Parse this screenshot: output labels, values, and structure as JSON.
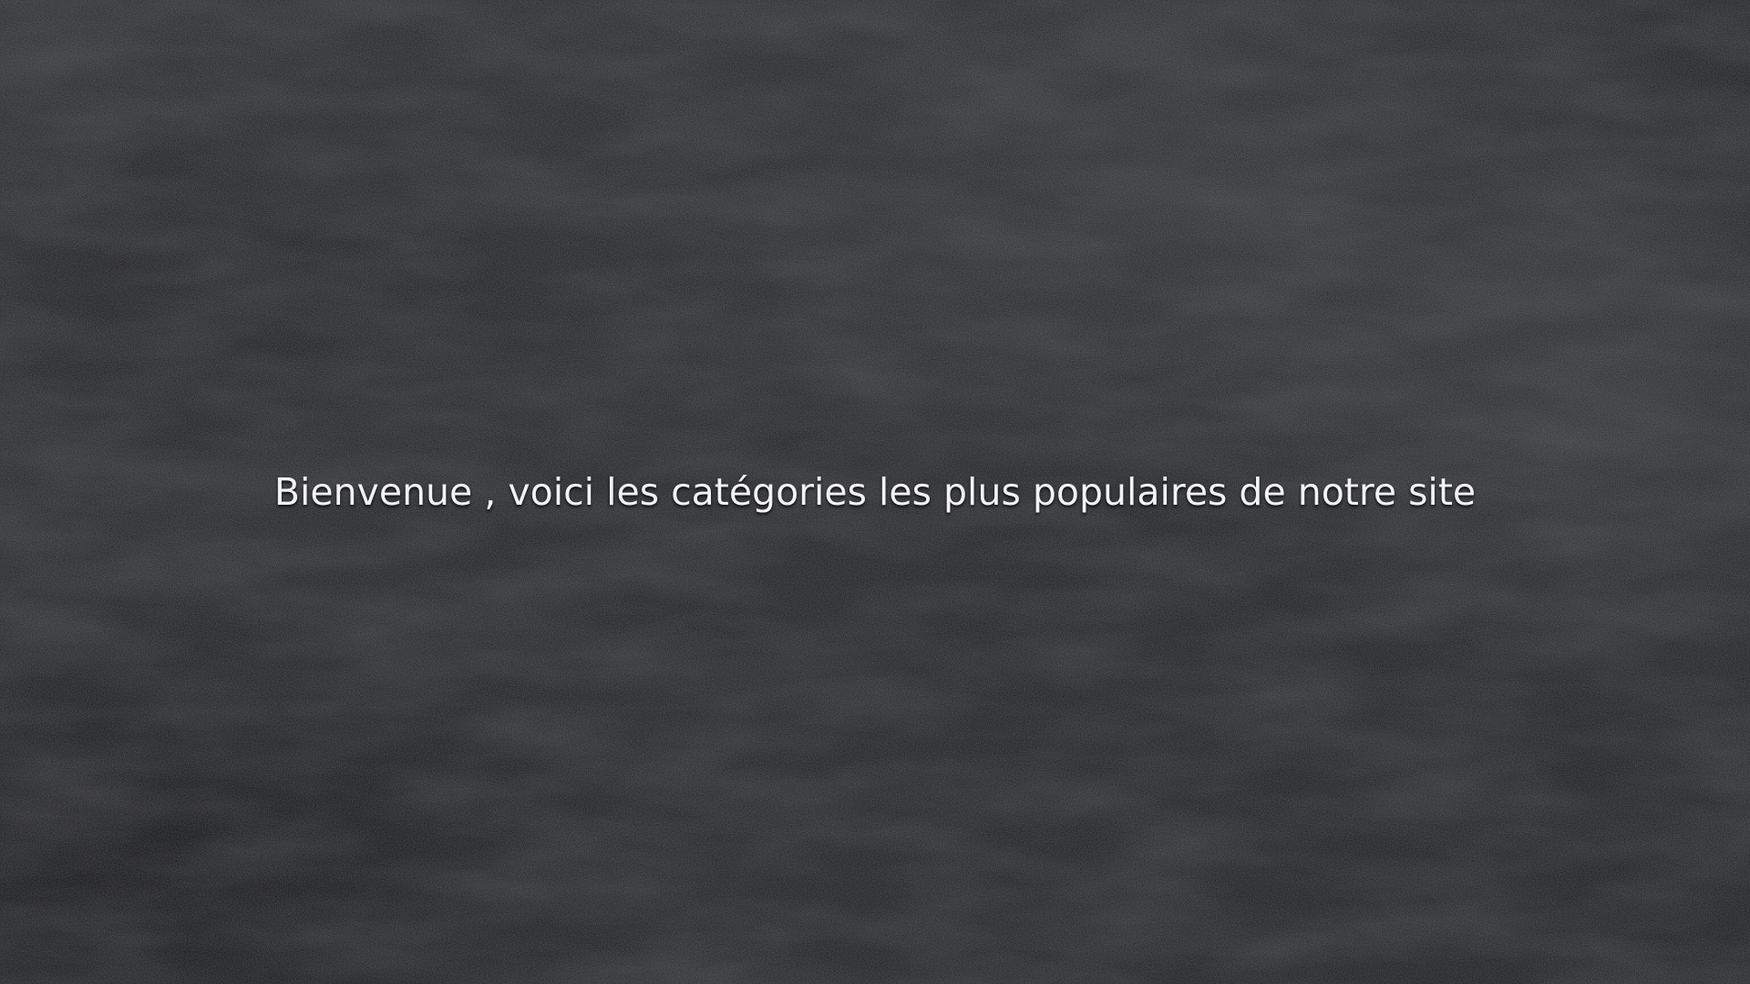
{
  "hero": {
    "background": "slate-texture",
    "background_color": "#252628",
    "welcome_text": "Bienvenue , voici les catégories les plus populaires de notre site",
    "text_color": "#f2f2f2"
  }
}
